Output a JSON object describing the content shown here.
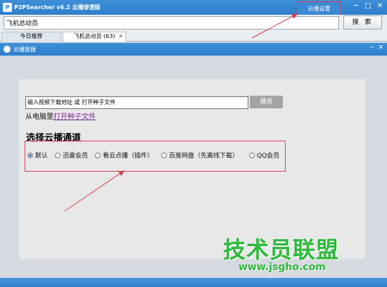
{
  "app": {
    "title": "P2PSearcher v6.2 云播穿透版",
    "icon_glyph": "P",
    "cloud_settings_label": "云播设置",
    "window_controls": [
      "─",
      "□",
      "✕"
    ]
  },
  "search": {
    "value": "飞机总动员",
    "button_label": "搜 索"
  },
  "tabs": [
    {
      "label": "今日推荐",
      "active": false
    },
    {
      "label": "飞机总动员 (63)",
      "active": true,
      "close": "✕"
    }
  ],
  "player_window": {
    "title": "云播放器",
    "controls": [
      "─",
      "✕"
    ]
  },
  "player": {
    "url_value": "输入视频下载地址 或 打开种子文件",
    "play_label": "播放",
    "local_prefix": "从电脑里",
    "local_link": "打开种子文件"
  },
  "channels": {
    "title": "选择云播通道",
    "options": [
      {
        "label": "默认",
        "checked": true
      },
      {
        "label": "迅雷会员",
        "checked": false
      },
      {
        "label": "看云点播（插件）",
        "checked": false
      },
      {
        "label": "百度网盘（先离线下载）",
        "checked": false
      },
      {
        "label": "QQ会员",
        "checked": false
      }
    ]
  },
  "watermark": {
    "brand": "技术员联盟",
    "url": "www.jsgho.com"
  },
  "colors": {
    "title_blue": "#2f7fcc",
    "highlight_red": "#d93a4c",
    "link_purple": "#7b2a9b",
    "watermark_green": "#2db93b"
  }
}
